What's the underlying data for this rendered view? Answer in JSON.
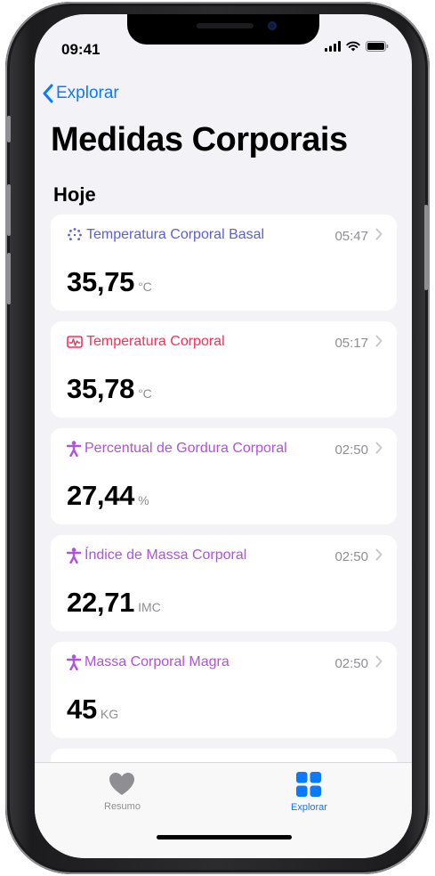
{
  "status_bar": {
    "time": "09:41"
  },
  "nav": {
    "back_label": "Explorar"
  },
  "page": {
    "title": "Medidas Corporais",
    "section": "Hoje"
  },
  "colors": {
    "accent": "#0a7aff",
    "basal": "#5b5fd6",
    "temp": "#ff2d55",
    "body": "#af52de"
  },
  "cards": [
    {
      "icon": "dotted-circle-icon",
      "label": "Temperatura Corporal Basal",
      "time": "05:47",
      "value": "35,75",
      "unit": "°C"
    },
    {
      "icon": "thermometer-chart-icon",
      "label": "Temperatura Corporal",
      "time": "05:17",
      "value": "35,78",
      "unit": "°C"
    },
    {
      "icon": "person-icon",
      "label": "Percentual de Gordura Corporal",
      "time": "02:50",
      "value": "27,44",
      "unit": "%"
    },
    {
      "icon": "person-icon",
      "label": "Índice de Massa Corporal",
      "time": "02:50",
      "value": "22,71",
      "unit": "IMC"
    },
    {
      "icon": "person-icon",
      "label": "Massa Corporal Magra",
      "time": "02:50",
      "value": "45",
      "unit": "KG"
    }
  ],
  "tabbar": {
    "resumo_label": "Resumo",
    "explorar_label": "Explorar"
  }
}
